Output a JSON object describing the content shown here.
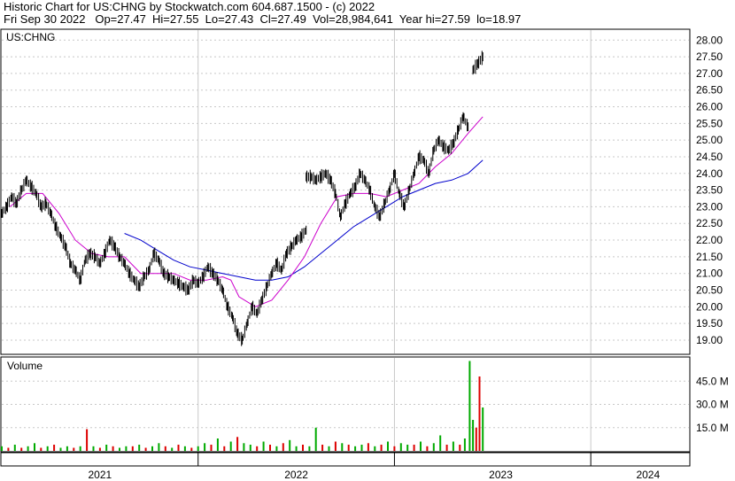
{
  "header": {
    "line1": "Historic Chart for US:CHNG by Stockwatch.com 604.687.1500 - (c) 2022",
    "line2": "Fri Sep 30 2022   Op=27.47  Hi=27.55  Lo=27.43  Cl=27.49  Vol=28,984,641  Year hi=27.59  lo=18.97"
  },
  "chart_data": [
    {
      "type": "line",
      "symbol_label": "US:CHNG",
      "ylim": [
        18.6,
        28.3
      ],
      "yticks": [
        "28.00",
        "27.50",
        "27.00",
        "26.50",
        "26.00",
        "25.50",
        "25.00",
        "24.50",
        "24.00",
        "23.50",
        "23.00",
        "22.50",
        "22.00",
        "21.50",
        "21.00",
        "20.50",
        "20.00",
        "19.50",
        "19.00"
      ],
      "x_labels": [
        "2021",
        "2022",
        "2023",
        "2024"
      ],
      "x_label_months": [
        6,
        18,
        30.5,
        39.5
      ],
      "x_dividers": [
        12,
        24,
        36
      ],
      "xlim": [
        0,
        42
      ],
      "colors": {
        "price": "#000000",
        "ma_short": "#cc00cc",
        "ma_long": "#0000cc",
        "grid": "#c8c8c8"
      },
      "price": [
        [
          0.0,
          22.8
        ],
        [
          0.3,
          23.0
        ],
        [
          0.6,
          23.3
        ],
        [
          0.9,
          23.1
        ],
        [
          1.2,
          23.5
        ],
        [
          1.5,
          23.8
        ],
        [
          1.8,
          23.6
        ],
        [
          2.1,
          23.4
        ],
        [
          2.4,
          23.0
        ],
        [
          2.7,
          23.1
        ],
        [
          3.0,
          22.8
        ],
        [
          3.3,
          22.4
        ],
        [
          3.6,
          22.1
        ],
        [
          3.9,
          21.8
        ],
        [
          4.2,
          21.3
        ],
        [
          4.5,
          21.1
        ],
        [
          4.8,
          20.8
        ],
        [
          5.1,
          21.4
        ],
        [
          5.4,
          21.6
        ],
        [
          5.7,
          21.5
        ],
        [
          6.0,
          21.3
        ],
        [
          6.3,
          21.6
        ],
        [
          6.6,
          22.0
        ],
        [
          6.9,
          21.8
        ],
        [
          7.2,
          21.5
        ],
        [
          7.5,
          21.3
        ],
        [
          7.8,
          21.0
        ],
        [
          8.1,
          20.8
        ],
        [
          8.4,
          20.6
        ],
        [
          8.7,
          20.9
        ],
        [
          9.0,
          21.1
        ],
        [
          9.3,
          21.6
        ],
        [
          9.6,
          21.4
        ],
        [
          9.9,
          21.0
        ],
        [
          10.2,
          20.9
        ],
        [
          10.5,
          20.8
        ],
        [
          10.8,
          20.7
        ],
        [
          11.1,
          20.6
        ],
        [
          11.4,
          20.5
        ],
        [
          11.7,
          20.8
        ],
        [
          12.0,
          20.7
        ],
        [
          12.3,
          20.9
        ],
        [
          12.6,
          21.2
        ],
        [
          12.9,
          21.0
        ],
        [
          13.2,
          20.8
        ],
        [
          13.5,
          20.5
        ],
        [
          13.8,
          20.0
        ],
        [
          14.1,
          19.7
        ],
        [
          14.4,
          19.2
        ],
        [
          14.7,
          19.0
        ],
        [
          15.0,
          19.5
        ],
        [
          15.3,
          20.0
        ],
        [
          15.6,
          19.8
        ],
        [
          15.9,
          20.2
        ],
        [
          16.2,
          20.6
        ],
        [
          16.5,
          21.0
        ],
        [
          16.8,
          21.3
        ],
        [
          17.1,
          21.1
        ],
        [
          17.4,
          21.6
        ],
        [
          17.7,
          21.8
        ],
        [
          18.0,
          22.0
        ],
        [
          18.3,
          22.1
        ],
        [
          18.6,
          22.3
        ],
        [
          18.6,
          23.9
        ],
        [
          18.9,
          23.9
        ],
        [
          19.2,
          23.8
        ],
        [
          19.5,
          23.9
        ],
        [
          19.8,
          24.0
        ],
        [
          20.1,
          23.8
        ],
        [
          20.4,
          23.4
        ],
        [
          20.7,
          22.7
        ],
        [
          21.0,
          23.1
        ],
        [
          21.3,
          23.4
        ],
        [
          21.6,
          23.6
        ],
        [
          21.9,
          24.0
        ],
        [
          22.2,
          23.8
        ],
        [
          22.5,
          23.5
        ],
        [
          22.8,
          23.0
        ],
        [
          23.1,
          22.7
        ],
        [
          23.4,
          23.1
        ],
        [
          23.7,
          23.5
        ],
        [
          24.0,
          24.0
        ],
        [
          24.3,
          23.4
        ],
        [
          24.6,
          23.0
        ],
        [
          24.9,
          23.5
        ],
        [
          25.2,
          24.0
        ],
        [
          25.5,
          24.5
        ],
        [
          25.8,
          24.4
        ],
        [
          26.1,
          24.0
        ],
        [
          26.4,
          24.7
        ],
        [
          26.7,
          25.0
        ],
        [
          27.0,
          24.8
        ],
        [
          27.3,
          24.7
        ],
        [
          27.6,
          24.9
        ],
        [
          27.9,
          25.3
        ],
        [
          28.2,
          25.7
        ],
        [
          28.5,
          25.4
        ],
        [
          28.8,
          27.1
        ],
        [
          29.1,
          27.3
        ],
        [
          29.4,
          27.5
        ]
      ],
      "ma_short": [
        [
          0.5,
          23.0
        ],
        [
          1.5,
          23.4
        ],
        [
          2.5,
          23.4
        ],
        [
          3.5,
          22.8
        ],
        [
          4.5,
          22.0
        ],
        [
          5.5,
          21.6
        ],
        [
          6.5,
          21.5
        ],
        [
          7.5,
          21.5
        ],
        [
          8.5,
          21.0
        ],
        [
          9.5,
          21.0
        ],
        [
          10.5,
          21.0
        ],
        [
          11.5,
          20.8
        ],
        [
          12.5,
          20.8
        ],
        [
          13.5,
          20.9
        ],
        [
          14.0,
          20.8
        ],
        [
          14.5,
          20.3
        ],
        [
          15.5,
          20.0
        ],
        [
          16.5,
          20.2
        ],
        [
          17.5,
          20.8
        ],
        [
          18.5,
          21.5
        ],
        [
          19.5,
          22.5
        ],
        [
          20.5,
          23.3
        ],
        [
          21.5,
          23.4
        ],
        [
          22.5,
          23.4
        ],
        [
          23.5,
          23.3
        ],
        [
          24.5,
          23.5
        ],
        [
          25.5,
          23.7
        ],
        [
          26.5,
          24.2
        ],
        [
          27.5,
          24.6
        ],
        [
          28.5,
          25.2
        ],
        [
          29.4,
          25.7
        ]
      ],
      "ma_long": [
        [
          7.5,
          22.2
        ],
        [
          8.5,
          22.0
        ],
        [
          9.5,
          21.7
        ],
        [
          10.5,
          21.4
        ],
        [
          11.5,
          21.2
        ],
        [
          12.5,
          21.1
        ],
        [
          13.5,
          21.0
        ],
        [
          14.5,
          20.9
        ],
        [
          15.5,
          20.8
        ],
        [
          16.5,
          20.8
        ],
        [
          17.5,
          20.9
        ],
        [
          18.5,
          21.2
        ],
        [
          19.5,
          21.6
        ],
        [
          20.5,
          22.0
        ],
        [
          21.5,
          22.4
        ],
        [
          22.5,
          22.7
        ],
        [
          23.5,
          23.0
        ],
        [
          24.5,
          23.3
        ],
        [
          25.5,
          23.5
        ],
        [
          26.5,
          23.7
        ],
        [
          27.5,
          23.8
        ],
        [
          28.5,
          24.0
        ],
        [
          29.4,
          24.4
        ]
      ]
    },
    {
      "type": "bar",
      "series_label": "Volume",
      "yticks": [
        "45.0 M",
        "30.0 M",
        "15.0 M"
      ],
      "ytick_values": [
        45,
        30,
        15
      ],
      "ylim": [
        0,
        60
      ],
      "colors": {
        "up": "#00aa00",
        "down": "#dd0000"
      },
      "x_values": [
        0.0,
        0.4,
        0.8,
        1.2,
        1.6,
        2.0,
        2.4,
        2.8,
        3.2,
        3.6,
        4.0,
        4.4,
        4.8,
        5.2,
        5.6,
        6.0,
        6.4,
        6.8,
        7.2,
        7.6,
        8.0,
        8.4,
        8.8,
        9.2,
        9.6,
        10.0,
        10.4,
        10.8,
        11.2,
        11.6,
        12.0,
        12.4,
        12.8,
        13.2,
        13.6,
        14.0,
        14.4,
        14.8,
        15.2,
        15.6,
        16.0,
        16.4,
        16.8,
        17.2,
        17.6,
        18.0,
        18.4,
        18.8,
        19.2,
        19.6,
        20.0,
        20.4,
        20.8,
        21.2,
        21.6,
        22.0,
        22.4,
        22.8,
        23.2,
        23.6,
        24.0,
        24.4,
        24.8,
        25.2,
        25.6,
        26.0,
        26.4,
        26.8,
        27.2,
        27.6,
        28.0,
        28.3,
        28.6,
        28.8,
        29.0,
        29.2,
        29.4
      ],
      "values": [
        3,
        2,
        4,
        2,
        3,
        5,
        2,
        3,
        4,
        2,
        3,
        2,
        3,
        14,
        3,
        2,
        4,
        3,
        2,
        3,
        3,
        4,
        2,
        3,
        5,
        3,
        2,
        4,
        3,
        2,
        3,
        5,
        4,
        8,
        3,
        6,
        9,
        5,
        4,
        3,
        6,
        4,
        3,
        5,
        7,
        3,
        4,
        3,
        15,
        4,
        3,
        6,
        5,
        4,
        3,
        4,
        5,
        3,
        4,
        6,
        3,
        5,
        4,
        4,
        6,
        3,
        5,
        10,
        4,
        6,
        4,
        8,
        58,
        20,
        15,
        48,
        28
      ],
      "up": [
        1,
        0,
        1,
        0,
        1,
        1,
        0,
        1,
        0,
        1,
        1,
        0,
        1,
        0,
        1,
        0,
        1,
        0,
        1,
        1,
        0,
        1,
        0,
        1,
        1,
        0,
        1,
        0,
        1,
        0,
        1,
        1,
        0,
        1,
        0,
        1,
        0,
        1,
        1,
        0,
        1,
        0,
        1,
        0,
        1,
        1,
        0,
        1,
        1,
        0,
        1,
        0,
        1,
        0,
        1,
        1,
        0,
        1,
        0,
        1,
        0,
        1,
        1,
        0,
        1,
        0,
        1,
        1,
        0,
        1,
        0,
        1,
        1,
        1,
        0,
        0,
        1
      ]
    }
  ]
}
